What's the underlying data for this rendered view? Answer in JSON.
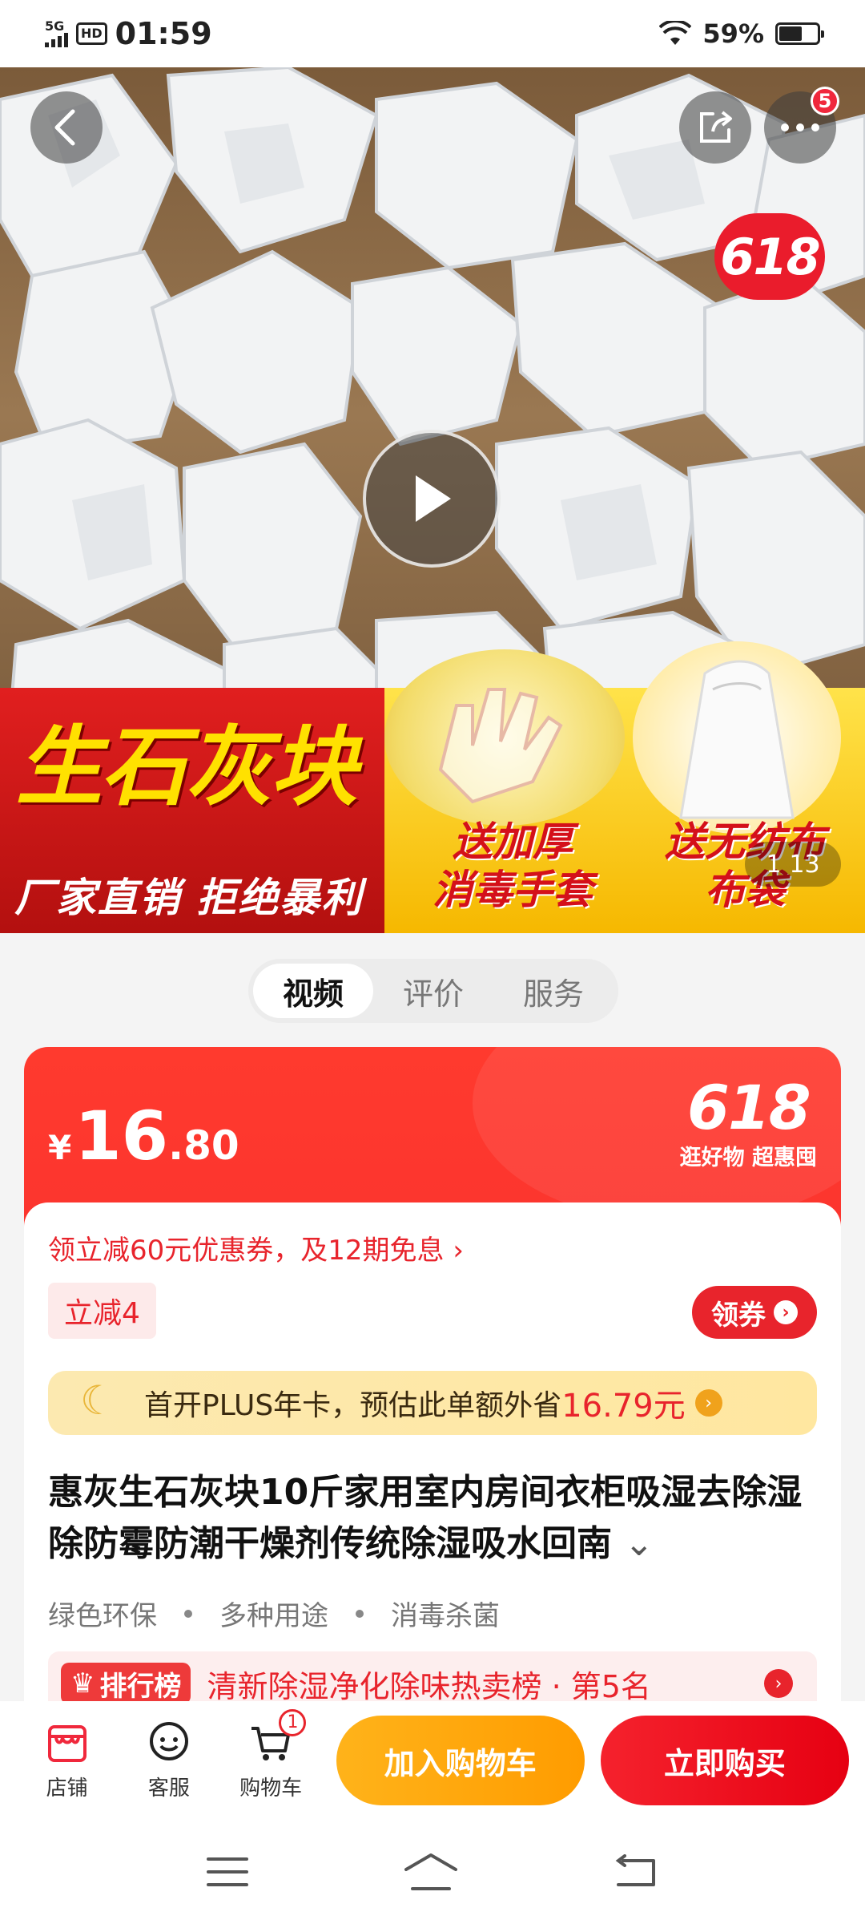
{
  "status_bar": {
    "network": "5G",
    "hd": "HD",
    "time": "01:59",
    "battery": "59%"
  },
  "hero": {
    "more_badge": "5",
    "promo_618": "618",
    "banner_title": "生石灰块",
    "banner_subtitle": "厂家直销 拒绝暴利",
    "gift1": "送加厚\n消毒手套",
    "gift2": "送无纺布\n布袋",
    "image_index": "1",
    "image_total": "13"
  },
  "tabs": [
    {
      "label": "视频"
    },
    {
      "label": "评价"
    },
    {
      "label": "服务"
    }
  ],
  "price": {
    "currency": "¥",
    "integer": "16",
    "decimal": ".80",
    "promo_big": "618",
    "promo_small": "逛好物 超惠囤"
  },
  "coupon": {
    "line": "领立减60元优惠券，及12期免息 ›",
    "reduce_chip": "立减4",
    "get_label": "领券"
  },
  "plus": {
    "text": "首开PLUS年卡，预估此单额外省",
    "amount": "16.79元"
  },
  "product": {
    "title": "惠灰生石灰块10斤家用室内房间衣柜吸湿去除湿除防霉防潮干燥剂传统除湿吸水回南",
    "tags": [
      "绿色环保",
      "多种用途",
      "消毒杀菌"
    ]
  },
  "rank": {
    "badge": "排行榜",
    "text": "清新除湿净化除味热卖榜 · 第5名"
  },
  "action_bar": {
    "shop": "店铺",
    "service": "客服",
    "cart": "购物车",
    "cart_count": "1",
    "add_to_cart": "加入购物车",
    "buy_now": "立即购买"
  },
  "colors": {
    "brand_red": "#e8242c",
    "cart_orange": "#ffa500"
  }
}
